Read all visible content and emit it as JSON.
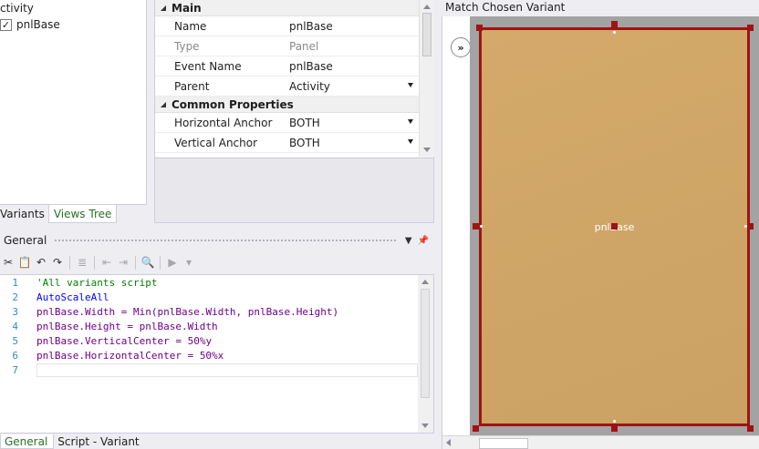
{
  "views_tree": {
    "root_label": "ctivity",
    "node_label": "pnlBase",
    "node_checked": true,
    "tabs": [
      {
        "label": "Variants",
        "active": false
      },
      {
        "label": "Views Tree",
        "active": true
      }
    ]
  },
  "properties": {
    "categories": [
      {
        "name": "Main",
        "rows": [
          {
            "name": "Name",
            "value": "pnlBase",
            "dropdown": false,
            "readonly": false
          },
          {
            "name": "Type",
            "value": "Panel",
            "dropdown": false,
            "readonly": true
          },
          {
            "name": "Event Name",
            "value": "pnlBase",
            "dropdown": false,
            "readonly": false
          },
          {
            "name": "Parent",
            "value": "Activity",
            "dropdown": true,
            "readonly": false
          }
        ]
      },
      {
        "name": "Common Properties",
        "rows": [
          {
            "name": "Horizontal Anchor",
            "value": "BOTH",
            "dropdown": true,
            "readonly": false
          },
          {
            "name": "Vertical Anchor",
            "value": "BOTH",
            "dropdown": true,
            "readonly": false
          }
        ]
      }
    ]
  },
  "code_editor": {
    "title": "General",
    "lines": [
      {
        "num": "1",
        "tokens": [
          {
            "t": "'All variants script",
            "c": "comment"
          }
        ]
      },
      {
        "num": "2",
        "tokens": [
          {
            "t": "AutoScaleAll",
            "c": "kw"
          }
        ]
      },
      {
        "num": "3",
        "tokens": [
          {
            "t": "pnlBase",
            "c": "id"
          },
          {
            "t": ".Width = ",
            "c": "id"
          },
          {
            "t": "Min",
            "c": "id"
          },
          {
            "t": "(pnlBase.Width, pnlBase.Height)",
            "c": "id"
          }
        ]
      },
      {
        "num": "4",
        "tokens": [
          {
            "t": "pnlBase.Height = pnlBase.Width",
            "c": "id"
          }
        ]
      },
      {
        "num": "5",
        "tokens": [
          {
            "t": "pnlBase.VerticalCenter = ",
            "c": "id"
          },
          {
            "t": "50%y",
            "c": "id"
          }
        ]
      },
      {
        "num": "6",
        "tokens": [
          {
            "t": "pnlBase.HorizontalCenter = ",
            "c": "id"
          },
          {
            "t": "50%x",
            "c": "id"
          }
        ]
      },
      {
        "num": "7",
        "tokens": [],
        "current": true
      }
    ]
  },
  "bottom_tabs": [
    {
      "label": "General",
      "active": true
    },
    {
      "label": "Script - Variant",
      "active": false
    }
  ],
  "designer": {
    "title": "Match Chosen Variant",
    "panel_label": "pnlBase",
    "panel_color": "#cfa668",
    "border_color": "#a01313",
    "expand_icon": "double-chevron-right-icon"
  }
}
